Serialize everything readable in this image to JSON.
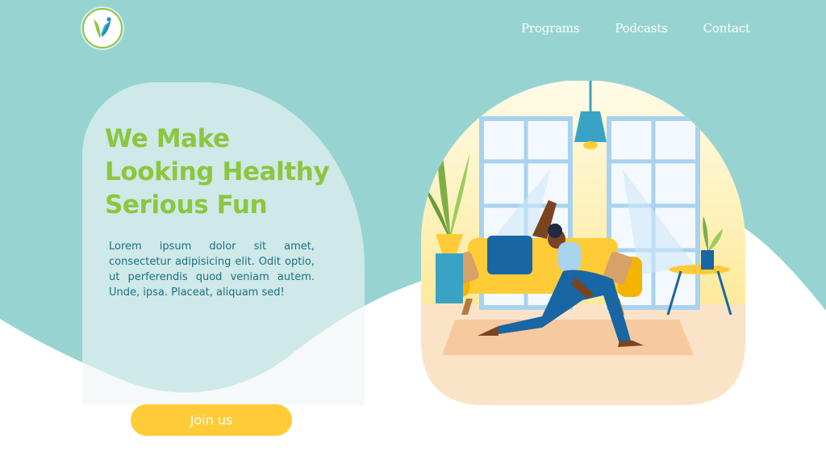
{
  "nav": {
    "items": [
      "Programs",
      "Podcasts",
      "Contact"
    ]
  },
  "hero": {
    "headline": [
      "We Make",
      "Looking Healthy",
      "Serious Fun"
    ],
    "body": "Lorem ipsum dolor sit amet, consectetur adipisicing elit. Odit optio, ut perferendis quod veniam autem. Unde, ipsa. Placeat, aliquam sed!",
    "cta_label": "Join us"
  },
  "icons": {
    "logo": "leaf-person-logo-icon",
    "illustration": "yoga-living-room-illustration"
  },
  "colors": {
    "teal_background": "#97d4d1",
    "headline_green": "#8cc63f",
    "body_text_blue": "#1c6f86",
    "cta_yellow": "#ffcb37",
    "nav_text": "#ffffff"
  }
}
